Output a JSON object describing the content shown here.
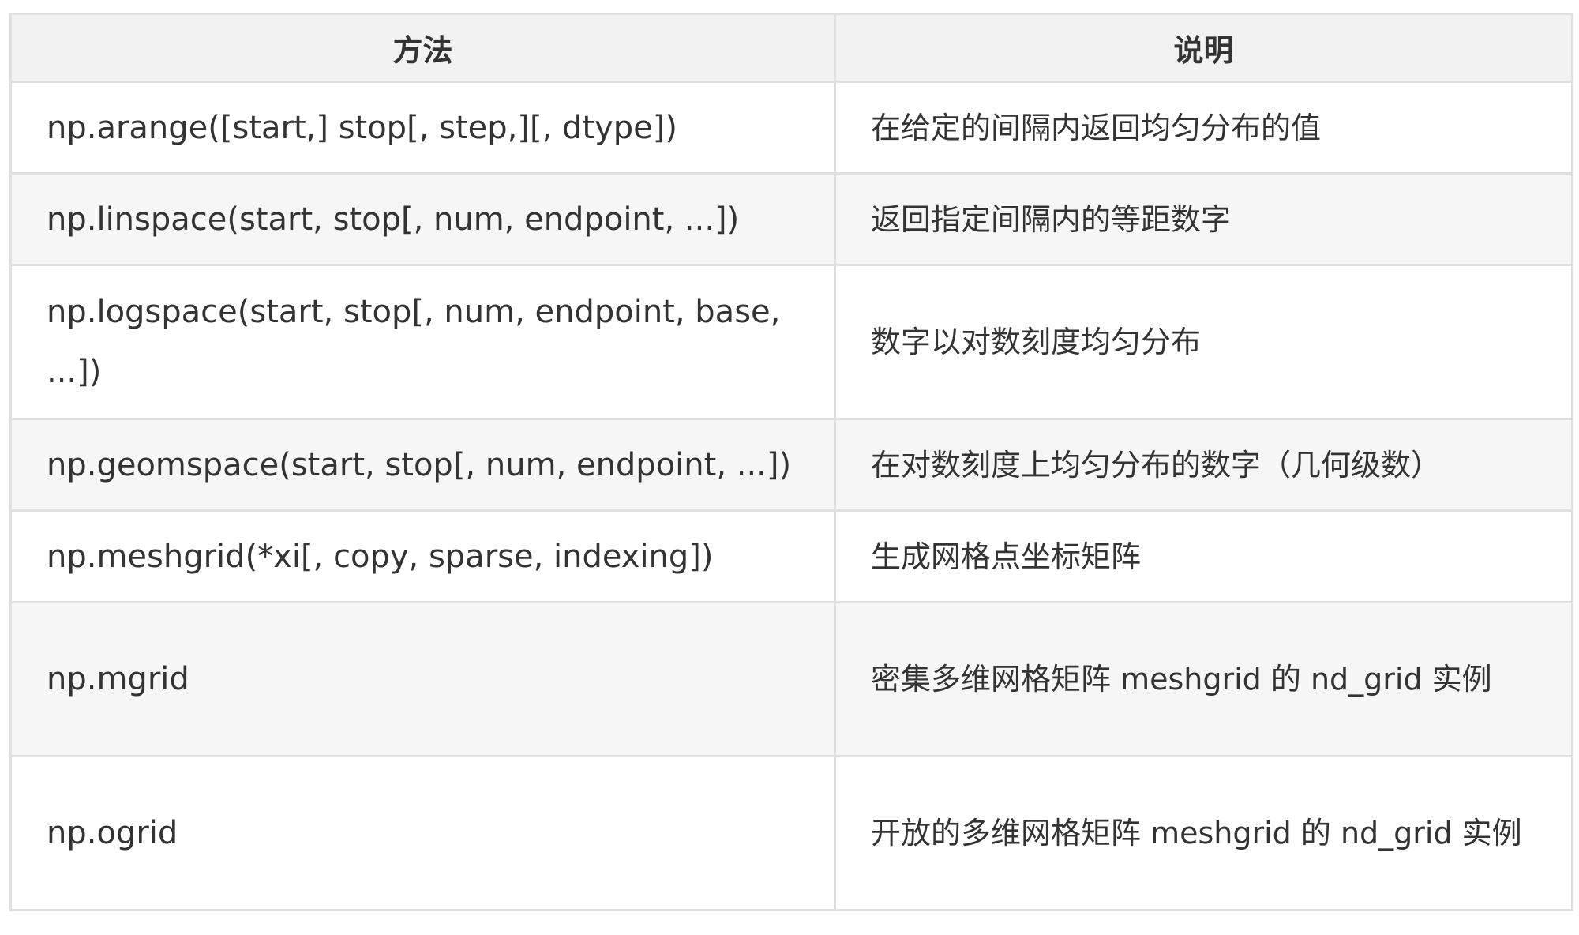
{
  "table": {
    "headers": [
      "方法",
      "说明"
    ],
    "rows": [
      {
        "method": "np.arange([start,] stop[, step,][, dtype])",
        "description": "在给定的间隔内返回均匀分布的值"
      },
      {
        "method": "np.linspace(start, stop[, num, endpoint, ...])",
        "description": "返回指定间隔内的等距数字"
      },
      {
        "method": "np.logspace(start, stop[, num, endpoint, base, ...])",
        "description": "数字以对数刻度均匀分布"
      },
      {
        "method": "np.geomspace(start, stop[, num, endpoint, ...])",
        "description": "在对数刻度上均匀分布的数字（几何级数）"
      },
      {
        "method": "np.meshgrid(*xi[, copy, sparse, indexing])",
        "description": "生成网格点坐标矩阵"
      },
      {
        "method": "np.mgrid",
        "description": "密集多维网格矩阵 meshgrid 的 nd_grid 实例"
      },
      {
        "method": "np.ogrid",
        "description": "开放的多维网格矩阵 meshgrid 的 nd_grid 实例"
      }
    ]
  }
}
